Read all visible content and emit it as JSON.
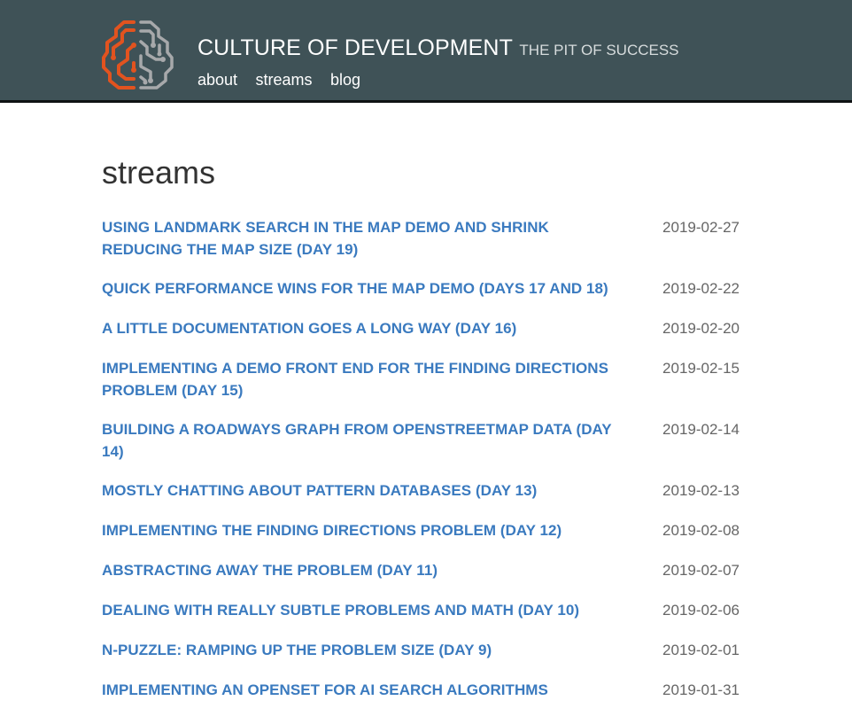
{
  "site": {
    "name": "CULTURE OF DEVELOPMENT",
    "tagline": "THE PIT OF SUCCESS",
    "logo_icon": "brain-circuit-icon",
    "colors": {
      "header_bg": "#3f5257",
      "logo_orange": "#e2531f",
      "logo_gray": "#a7a9ab",
      "link": "#3a7abf"
    }
  },
  "nav": {
    "about": "about",
    "streams": "streams",
    "blog": "blog"
  },
  "page": {
    "heading": "streams"
  },
  "posts": [
    {
      "title": "Using Landmark Search in the Map Demo and Shrink Reducing the Map Size (Day 19)",
      "date": "2019-02-27"
    },
    {
      "title": "Quick Performance Wins for the Map Demo (Days 17 and 18)",
      "date": "2019-02-22"
    },
    {
      "title": "A Little Documentation Goes a Long Way (Day 16)",
      "date": "2019-02-20"
    },
    {
      "title": "Implementing a Demo Front End for the Finding Directions Problem (Day 15)",
      "date": "2019-02-15"
    },
    {
      "title": "Building a Roadways Graph from OpenStreetMap Data (Day 14)",
      "date": "2019-02-14"
    },
    {
      "title": "Mostly Chatting About Pattern Databases (Day 13)",
      "date": "2019-02-13"
    },
    {
      "title": "Implementing the Finding Directions Problem (Day 12)",
      "date": "2019-02-08"
    },
    {
      "title": "Abstracting Away the Problem (Day 11)",
      "date": "2019-02-07"
    },
    {
      "title": "Dealing with Really Subtle Problems and Math (Day 10)",
      "date": "2019-02-06"
    },
    {
      "title": "N-Puzzle: Ramping Up the Problem Size (Day 9)",
      "date": "2019-02-01"
    },
    {
      "title": "Implementing an OpenSet for AI Search Algorithms",
      "date": "2019-01-31"
    }
  ]
}
